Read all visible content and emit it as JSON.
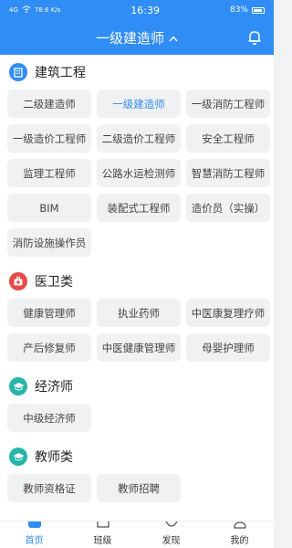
{
  "status_bar": {
    "signal": "4G",
    "speed": "78.6 K/s",
    "time": "16:39",
    "battery": "83%"
  },
  "header": {
    "title": "一级建造师",
    "arrow": "^"
  },
  "sections": [
    {
      "title": "建筑工程",
      "icon": "building-icon",
      "color": "#2f8df5",
      "items": [
        "二级建造师",
        "一级建造师",
        "一级消防工程师",
        "一级造价工程师",
        "二级造价工程师",
        "安全工程师",
        "监理工程师",
        "公路水运检测师",
        "智慧消防工程师",
        "BIM",
        "装配式工程师",
        "造价员（实操）",
        "消防设施操作员"
      ],
      "active": "一级建造师"
    },
    {
      "title": "医卫类",
      "icon": "medical-kit-icon",
      "color": "#e84a4a",
      "items": [
        "健康管理师",
        "执业药师",
        "中医康复理疗师",
        "产后修复师",
        "中医健康管理师",
        "母婴护理师"
      ]
    },
    {
      "title": "经济师",
      "icon": "graduation-cap-icon",
      "color": "#26b5a8",
      "items": [
        "中级经济师"
      ]
    },
    {
      "title": "教师类",
      "icon": "graduation-cap-icon",
      "color": "#26b5a8",
      "items": [
        "教师资格证",
        "教师招聘"
      ]
    }
  ],
  "tabs": [
    {
      "label": "首页",
      "icon": "home-icon",
      "active": true
    },
    {
      "label": "班级",
      "icon": "class-icon",
      "active": false
    },
    {
      "label": "发现",
      "icon": "discover-icon",
      "active": false
    },
    {
      "label": "我的",
      "icon": "profile-icon",
      "active": false
    }
  ],
  "colors": {
    "accent": "#2f8df5",
    "chip_bg": "#f0f1f3",
    "page_bg": "#ffffff"
  }
}
